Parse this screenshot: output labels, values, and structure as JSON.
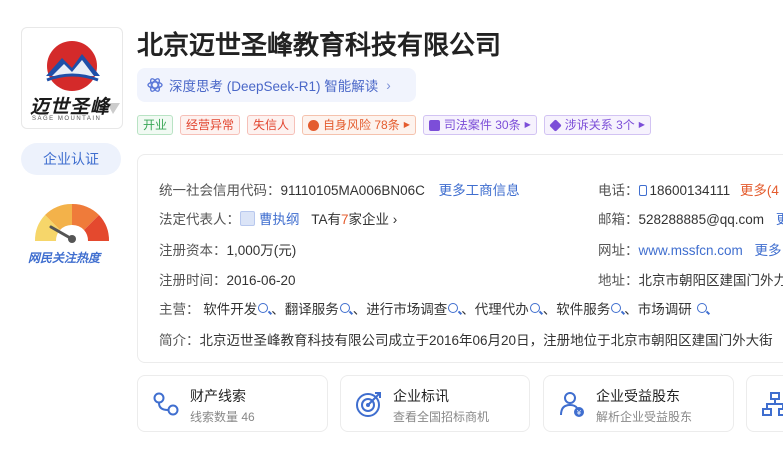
{
  "company": {
    "name": "北京迈世圣峰教育科技有限公司",
    "logo_text": "迈世圣峰",
    "logo_subtext": "SAGE MOUNTAIN",
    "cert_label": "企业认证",
    "heat_label": "网民关注热度"
  },
  "ai": {
    "label": "深度思考 (DeepSeek-R1) 智能解读"
  },
  "tags": [
    {
      "label": "开业",
      "style": "green"
    },
    {
      "label": "经营异常",
      "style": "red"
    },
    {
      "label": "失信人",
      "style": "red"
    },
    {
      "label": "自身风险 78条",
      "style": "orange"
    },
    {
      "label": "司法案件 30条",
      "style": "purple"
    },
    {
      "label": "涉诉关系 3个",
      "style": "purple"
    }
  ],
  "info": {
    "credit_code_label": "统一社会信用代码：",
    "credit_code": "91110105MA006BN06C",
    "more_business": "更多工商信息",
    "legal_label": "法定代表人：",
    "legal_name": "曹执纲",
    "ta_prefix": "TA有",
    "ta_count": "7",
    "ta_suffix": "家企业",
    "capital_label": "注册资本：",
    "capital": "1,000万(元)",
    "reg_time_label": "注册时间：",
    "reg_time": "2016-06-20",
    "main_label": "主营：",
    "main_items": [
      "软件开发",
      "翻译服务",
      "进行市场调查",
      "代理代办",
      "软件服务",
      "市场调研"
    ],
    "intro_label": "简介：",
    "intro": "北京迈世圣峰教育科技有限公司成立于2016年06月20日，注册地位于北京市朝阳区建国门外大街",
    "phone_label": "电话：",
    "phone": "18600134111",
    "phone_more": "更多(4",
    "email_label": "邮箱：",
    "email": "528288885@qq.com",
    "email_more": "更",
    "website_label": "网址：",
    "website": "www.mssfcn.com",
    "website_more": "更多",
    "address_label": "地址：",
    "address": "北京市朝阳区建国门外力"
  },
  "cards": [
    {
      "title": "财产线索",
      "sub": "线索数量 46",
      "icon": "link-nodes-icon"
    },
    {
      "title": "企业标讯",
      "sub": "查看全国招标商机",
      "icon": "target-icon"
    },
    {
      "title": "企业受益股东",
      "sub": "解析企业受益股东",
      "icon": "shareholder-icon"
    }
  ],
  "colors": {
    "accent": "#3f6ecf",
    "green": "#3aa757",
    "red": "#e2452f",
    "orange": "#e45c2e",
    "purple": "#7c4ed8"
  }
}
